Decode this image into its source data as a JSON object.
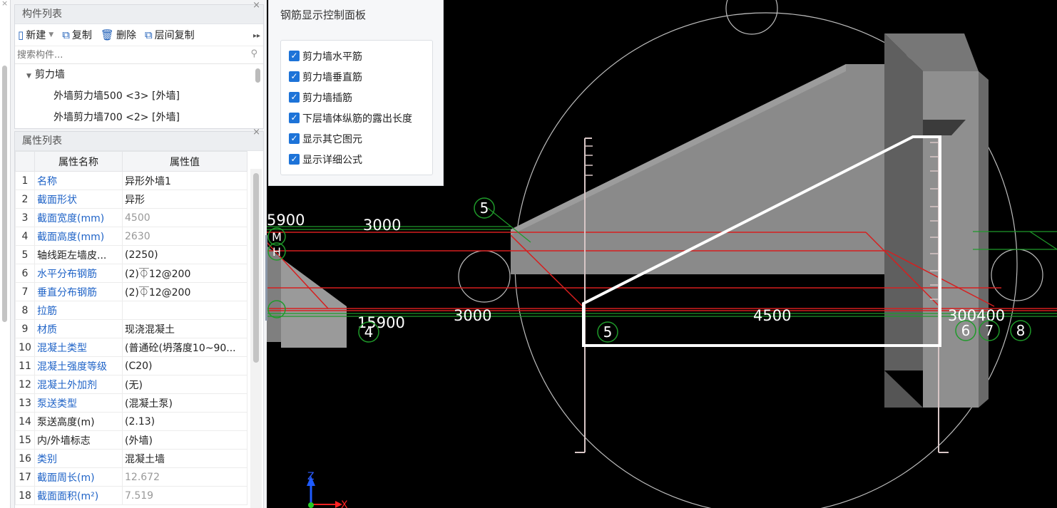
{
  "component_panel": {
    "title": "构件列表",
    "close": "×",
    "toolbar": {
      "new": "新建",
      "copy": "复制",
      "delete": "删除",
      "floor_copy": "层间复制"
    },
    "search_placeholder": "搜索构件...",
    "tree": {
      "root": "剪力墙",
      "items": [
        "外墙剪力墙500 <3> [外墙]",
        "外墙剪力墙700 <2> [外墙]"
      ]
    }
  },
  "property_panel": {
    "title": "属性列表",
    "close": "×",
    "col_name": "属性名称",
    "col_value": "属性值",
    "rows": [
      {
        "no": "1",
        "name": "名称",
        "value": "异形外墙1",
        "name_color": "blue",
        "value_color": "dark"
      },
      {
        "no": "2",
        "name": "截面形状",
        "value": "异形",
        "name_color": "blue",
        "value_color": "dark"
      },
      {
        "no": "3",
        "name": "截面宽度(mm)",
        "value": "4500",
        "name_color": "blue",
        "value_color": "gray"
      },
      {
        "no": "4",
        "name": "截面高度(mm)",
        "value": "2630",
        "name_color": "blue",
        "value_color": "gray"
      },
      {
        "no": "5",
        "name": "轴线距左墙皮...",
        "value": "(2250)",
        "name_color": "dark",
        "value_color": "dark"
      },
      {
        "no": "6",
        "name": "水平分布钢筋",
        "value": "(2)⏁12@200",
        "name_color": "blue",
        "value_color": "dark"
      },
      {
        "no": "7",
        "name": "垂直分布钢筋",
        "value": "(2)⏁12@200",
        "name_color": "blue",
        "value_color": "dark"
      },
      {
        "no": "8",
        "name": "拉筋",
        "value": "",
        "name_color": "blue",
        "value_color": "dark"
      },
      {
        "no": "9",
        "name": "材质",
        "value": "现浇混凝土",
        "name_color": "blue",
        "value_color": "dark"
      },
      {
        "no": "10",
        "name": "混凝土类型",
        "value": "(普通砼(坍落度10~90...",
        "name_color": "blue",
        "value_color": "dark"
      },
      {
        "no": "11",
        "name": "混凝土强度等级",
        "value": "(C20)",
        "name_color": "blue",
        "value_color": "dark"
      },
      {
        "no": "12",
        "name": "混凝土外加剂",
        "value": "(无)",
        "name_color": "blue",
        "value_color": "dark"
      },
      {
        "no": "13",
        "name": "泵送类型",
        "value": "(混凝土泵)",
        "name_color": "blue",
        "value_color": "dark"
      },
      {
        "no": "14",
        "name": "泵送高度(m)",
        "value": "(2.13)",
        "name_color": "dark",
        "value_color": "dark"
      },
      {
        "no": "15",
        "name": "内/外墙标志",
        "value": "(外墙)",
        "name_color": "dark",
        "value_color": "dark"
      },
      {
        "no": "16",
        "name": "类别",
        "value": "混凝土墙",
        "name_color": "blue",
        "value_color": "dark"
      },
      {
        "no": "17",
        "name": "截面周长(m)",
        "value": "12.672",
        "name_color": "blue",
        "value_color": "gray"
      },
      {
        "no": "18",
        "name": "截面面积(m²)",
        "value": "7.519",
        "name_color": "blue",
        "value_color": "gray"
      }
    ]
  },
  "rebar_panel": {
    "title": "钢筋显示控制面板",
    "options": [
      {
        "label": "剪力墙水平筋",
        "checked": true
      },
      {
        "label": "剪力墙垂直筋",
        "checked": true
      },
      {
        "label": "剪力墙插筋",
        "checked": true
      },
      {
        "label": "下层墙体纵筋的露出长度",
        "checked": true
      },
      {
        "label": "显示其它图元",
        "checked": true
      },
      {
        "label": "显示详细公式",
        "checked": true
      }
    ]
  },
  "viewport": {
    "dimensions": {
      "d_5900": "5900",
      "d_3000_top": "3000",
      "d_15900": "15900",
      "d_3000_bottom": "3000",
      "d_4500": "4500",
      "d_300400": "300400"
    },
    "axis_bubbles": {
      "b5_top": "5",
      "b5_bottom": "5",
      "b4": "4",
      "b6": "6",
      "b7": "7",
      "b8": "8",
      "bM": "M",
      "bH": "H"
    },
    "axis_labels": {
      "z": "Z",
      "x": "X"
    }
  },
  "colors": {
    "rebar_red": "#d61f1f",
    "axis_green": "#1f9a2a",
    "wall_gray": "#8e8e8e",
    "checkbox_blue": "#1d73d8",
    "link_blue": "#1f63c7"
  }
}
